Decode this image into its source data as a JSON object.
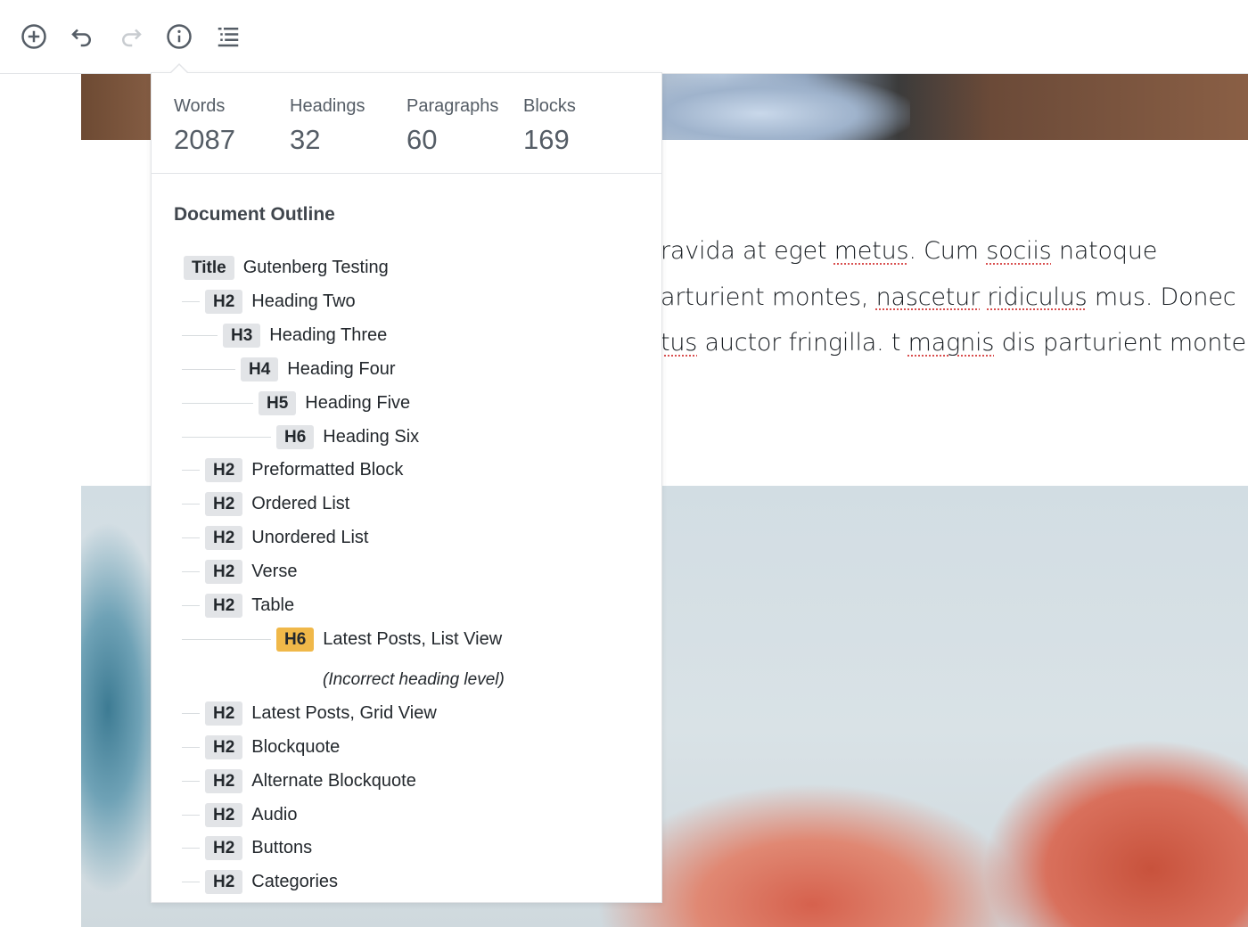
{
  "toolbar": {
    "add_icon": "plus-circle-icon",
    "undo_icon": "undo-icon",
    "redo_icon": "redo-icon",
    "info_icon": "info-icon",
    "outline_icon": "table-of-contents-icon"
  },
  "stats": [
    {
      "label": "Words",
      "value": "2087"
    },
    {
      "label": "Headings",
      "value": "32"
    },
    {
      "label": "Paragraphs",
      "value": "60"
    },
    {
      "label": "Blocks",
      "value": "169"
    }
  ],
  "outline": {
    "title": "Document Outline",
    "items": [
      {
        "level": "Title",
        "text": "Gutenberg Testing"
      },
      {
        "level": "H2",
        "text": "Heading Two"
      },
      {
        "level": "H3",
        "text": "Heading Three"
      },
      {
        "level": "H4",
        "text": "Heading Four"
      },
      {
        "level": "H5",
        "text": "Heading Five"
      },
      {
        "level": "H6",
        "text": "Heading Six"
      },
      {
        "level": "H2",
        "text": "Preformatted Block"
      },
      {
        "level": "H2",
        "text": "Ordered List"
      },
      {
        "level": "H2",
        "text": "Unordered List"
      },
      {
        "level": "H2",
        "text": "Verse"
      },
      {
        "level": "H2",
        "text": "Table"
      },
      {
        "level": "H6",
        "text": "Latest Posts, List View",
        "warning": true
      },
      {
        "level": "H2",
        "text": "Latest Posts, Grid View"
      },
      {
        "level": "H2",
        "text": "Blockquote"
      },
      {
        "level": "H2",
        "text": "Alternate Blockquote"
      },
      {
        "level": "H2",
        "text": "Audio"
      },
      {
        "level": "H2",
        "text": "Buttons"
      },
      {
        "level": "H2",
        "text": "Categories"
      }
    ],
    "warning_text": "(Incorrect heading level)"
  },
  "paragraph": {
    "line1_a": "ravida at eget ",
    "line1_b": "metus",
    "line1_c": ". Cum ",
    "line1_d": "sociis",
    "line1_e": " natoque",
    "line2_a": "arturient montes, ",
    "line2_b": "nascetur",
    "line2_c": " ",
    "line2_d": "ridiculus",
    "line2_e": " mus. Donec",
    "line3_a": "tus",
    "line3_b": " auctor fringilla. t ",
    "line3_c": "magnis",
    "line3_d": " dis parturient montes,"
  },
  "colors": {
    "warning_badge": "#f0b849",
    "badge": "#e2e4e7",
    "spellcheck": "#d94f4f"
  }
}
